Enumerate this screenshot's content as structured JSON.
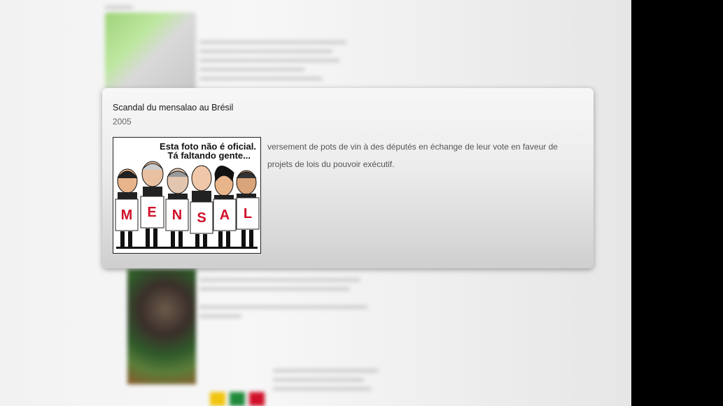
{
  "popup": {
    "title": "Scandal du mensalao au Brésil",
    "year": "2005",
    "image": {
      "caption_line1": "Esta foto não é oficial.",
      "caption_line2": "Tá faltando gente...",
      "letters": [
        "M",
        "E",
        "N",
        "S",
        "A",
        "L"
      ],
      "letter_color": "#d0102a"
    },
    "description": "versement de pots de vin à des députés en échange de leur vote en faveur de projets de lois du pouvoir exécutif."
  },
  "background": {
    "map_color": "#9fd37a"
  }
}
